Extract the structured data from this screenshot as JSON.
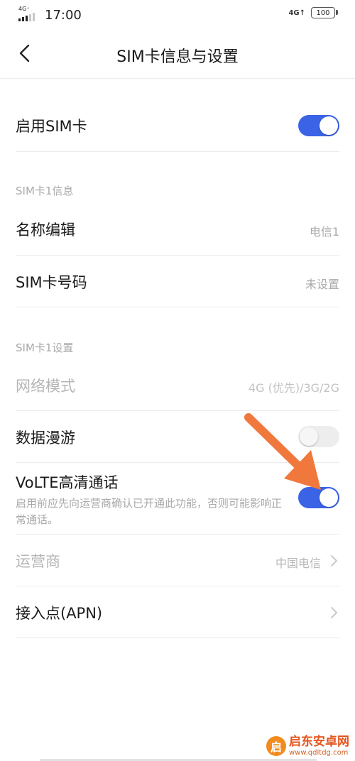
{
  "status_bar": {
    "network_small": "4G⁺",
    "time": "17:00",
    "network_right": "4G↑",
    "battery": "100"
  },
  "nav": {
    "title": "SIM卡信息与设置"
  },
  "enable_sim": {
    "label": "启用SIM卡",
    "enabled": true
  },
  "section_info": {
    "title": "SIM卡1信息",
    "rows": [
      {
        "label": "名称编辑",
        "value": "电信1"
      },
      {
        "label": "SIM卡号码",
        "value": "未设置"
      }
    ]
  },
  "section_settings": {
    "title": "SIM卡1设置",
    "network_mode": {
      "label": "网络模式",
      "value": "4G (优先)/3G/2G"
    },
    "data_roaming": {
      "label": "数据漫游",
      "enabled": false
    },
    "volte": {
      "label": "VoLTE高清通话",
      "description": "启用前应先向运营商确认已开通此功能，否则可能影响正常通话。",
      "enabled": true
    },
    "carrier": {
      "label": "运营商",
      "value": "中国电信"
    },
    "apn": {
      "label": "接入点(APN)"
    }
  },
  "watermark": {
    "logo": "启",
    "text": "启东安卓网",
    "url": "www.qdltdg.com"
  },
  "colors": {
    "toggle_on": "#3a63e6",
    "arrow": "#f0783c"
  }
}
